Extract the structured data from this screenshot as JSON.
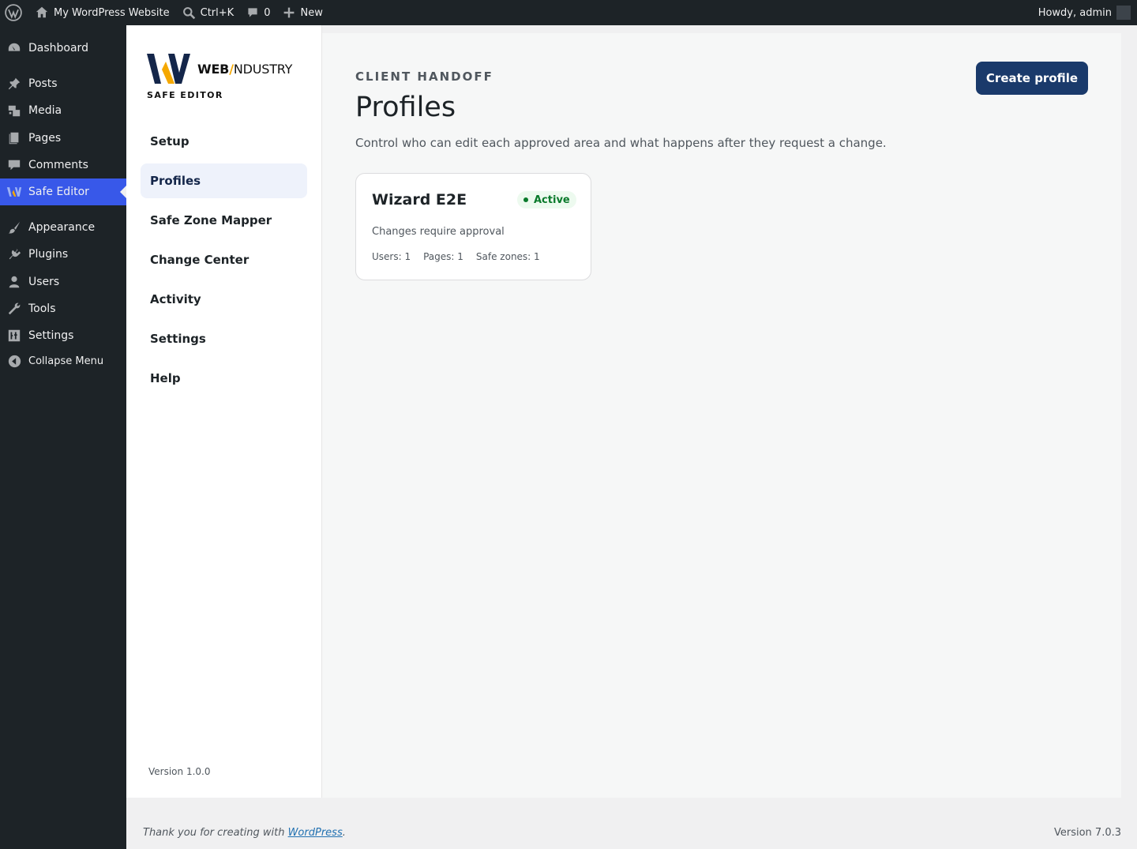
{
  "adminbar": {
    "site_name": "My WordPress Website",
    "search_shortcut": "Ctrl+K",
    "comments_count": "0",
    "new_label": "New",
    "howdy": "Howdy, admin"
  },
  "menu": {
    "items": [
      {
        "label": "Dashboard",
        "icon": "dashboard-icon"
      },
      {
        "label": "Posts",
        "icon": "pin-icon"
      },
      {
        "label": "Media",
        "icon": "media-icon"
      },
      {
        "label": "Pages",
        "icon": "pages-icon"
      },
      {
        "label": "Comments",
        "icon": "comment-icon"
      },
      {
        "label": "Safe Editor",
        "icon": "safe-editor-logo-icon"
      },
      {
        "label": "Appearance",
        "icon": "brush-icon"
      },
      {
        "label": "Plugins",
        "icon": "plugin-icon"
      },
      {
        "label": "Users",
        "icon": "user-icon"
      },
      {
        "label": "Tools",
        "icon": "wrench-icon"
      },
      {
        "label": "Settings",
        "icon": "settings-sliders-icon"
      }
    ],
    "collapse_label": "Collapse Menu"
  },
  "plugin": {
    "brand_name_bold": "WEB",
    "brand_name_rest": "NDUSTRY",
    "brand_subtitle": "SAFE EDITOR",
    "nav": [
      "Setup",
      "Profiles",
      "Safe Zone Mapper",
      "Change Center",
      "Activity",
      "Settings",
      "Help"
    ],
    "active_nav": "Profiles",
    "version": "Version 1.0.0"
  },
  "main": {
    "eyebrow": "CLIENT HANDOFF",
    "title": "Profiles",
    "description": "Control who can edit each approved area and what happens after they request a change.",
    "create_button": "Create profile",
    "profiles": [
      {
        "name": "Wizard E2E",
        "status": "Active",
        "mode": "Changes require approval",
        "users": "Users: 1",
        "pages": "Pages: 1",
        "safe_zones": "Safe zones: 1"
      }
    ]
  },
  "footer": {
    "thanks_prefix": "Thank you for creating with ",
    "thanks_link": "WordPress",
    "thanks_suffix": ".",
    "version": "Version 7.0.3"
  },
  "colors": {
    "admin_dark": "#1d2327",
    "menu_current": "#3858e9",
    "primary_button": "#1a3a6b",
    "active_badge": "#0a7a2b",
    "brand_accent": "#f5a800"
  }
}
